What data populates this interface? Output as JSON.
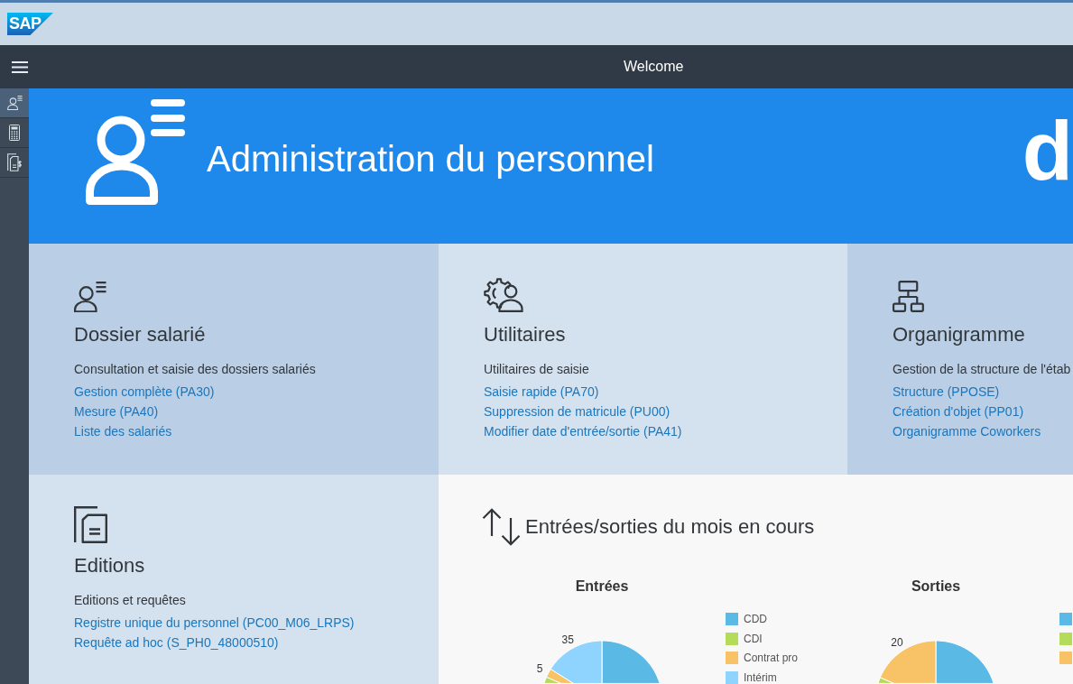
{
  "top_bar": {
    "logo": "SAP"
  },
  "shell_bar": {
    "title": "Welcome"
  },
  "sidebar": {
    "items": [
      {
        "selected": true
      },
      {
        "selected": false
      },
      {
        "selected": false
      }
    ]
  },
  "banner": {
    "title": "Administration du personnel",
    "logo": "d"
  },
  "tiles": [
    {
      "title": "Dossier salarié",
      "description": "Consultation et saisie des dossiers salariés",
      "links": [
        "Gestion complète (PA30)",
        "Mesure (PA40)",
        "Liste des salariés"
      ]
    },
    {
      "title": "Utilitaires",
      "description": "Utilitaires de saisie",
      "links": [
        "Saisie rapide (PA70)",
        "Suppression de matricule (PU00)",
        "Modifier date d'entrée/sortie (PA41)"
      ]
    },
    {
      "title": "Organigramme",
      "description": "Gestion de la structure de l'étab",
      "links": [
        "Structure (PPOSE)",
        "Création d'objet (PP01)",
        "Organigramme Coworkers"
      ]
    },
    {
      "title": "Editions",
      "description": "Editions et requêtes",
      "links": [
        "Registre unique du personnel (PC00_M06_LRPS)",
        "Requête ad hoc (S_PH0_48000510)"
      ]
    }
  ],
  "movements_panel": {
    "title": "Entrées/sorties du mois en cours",
    "charts": [
      {
        "title": "Entrées",
        "slices": [
          {
            "color": "#5ab9e5"
          },
          {
            "color": "#b4dc5a"
          },
          {
            "color": "#f8c366",
            "value_label": "5"
          },
          {
            "color": "#8fd3ff",
            "value_label": "35"
          }
        ],
        "legend": [
          {
            "label": "CDD",
            "color": "#5ab9e5"
          },
          {
            "label": "CDI",
            "color": "#b4dc5a"
          },
          {
            "label": "Contrat pro",
            "color": "#f8c366"
          },
          {
            "label": "Intérim",
            "color": "#8fd3ff"
          }
        ]
      },
      {
        "title": "Sorties",
        "slices": [
          {
            "color": "#5ab9e5"
          },
          {
            "color": "#b4dc5a"
          },
          {
            "color": "#f8c366",
            "value_label": "20"
          }
        ],
        "legend": [
          {
            "color": "#5ab9e5"
          },
          {
            "color": "#b4dc5a"
          },
          {
            "color": "#f8c366"
          }
        ]
      }
    ]
  }
}
